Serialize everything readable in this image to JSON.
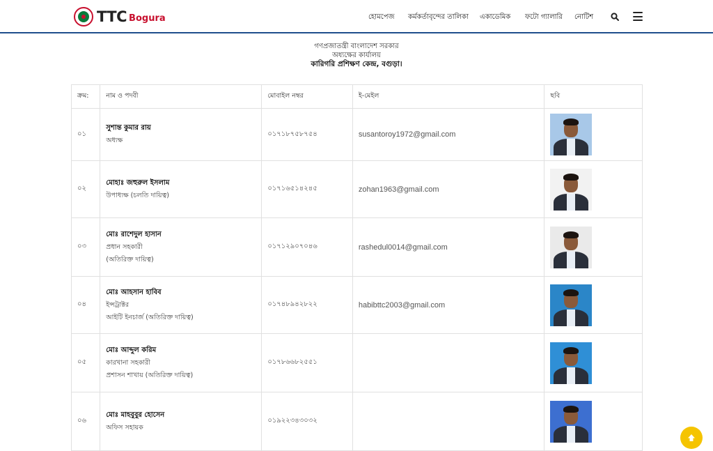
{
  "brand": {
    "name": "TTC",
    "city": "Bogura",
    "accent": "#c8102e",
    "nav_border": "#1f4e8c"
  },
  "nav": {
    "items": [
      "হোমপেজ",
      "কর্মকর্তাবৃন্দের তালিকা",
      "একাডেমিক",
      "ফটো গ্যালারি",
      "নোটিশ"
    ],
    "search_icon": "search-icon",
    "menu_icon": "hamburger-menu-icon"
  },
  "header": {
    "line1": "গণপ্রজাতন্ত্রী বাংলাদেশ সরকার",
    "line2": "অধ্যক্ষের কার্যালয়",
    "line3": "কারিগরি প্রশিক্ষণ কেন্দ্র, বগুড়া।"
  },
  "table": {
    "headers": [
      "ক্রম:",
      "নাম ও পদবী",
      "মোবাইল নম্বর",
      "ই-মেইল",
      "ছবি"
    ],
    "rows": [
      {
        "no": "০১",
        "name": "সুশান্ত কুমার রায়",
        "desig": [
          "অধ্যক্ষ"
        ],
        "mobile": "০১৭১৮৭৫৮৭৫৪",
        "email": "susantoroy1972@gmail.com",
        "photo_bg": "#a8c8e8"
      },
      {
        "no": "০২",
        "name": "মোহাঃ জহুরুল ইসলাম",
        "desig": [
          "উপাধ্যক্ষ (চলতি দায়িত্ব)"
        ],
        "mobile": "০১৭১৬৫১৪২৪৫",
        "email": "zohan1963@gmail.com",
        "photo_bg": "#f2f2f2"
      },
      {
        "no": "০৩",
        "name": "মোঃ রাশেদুল হাসান",
        "desig": [
          "প্রধান সহকারী",
          "(অতিরিক্ত দায়িত্ব)"
        ],
        "mobile": "০১৭১২৯০৭০৪৬",
        "email": "rashedul0014@gmail.com",
        "photo_bg": "#eaeaea"
      },
      {
        "no": "০৪",
        "name": "মোঃ আহসান হাবিব",
        "desig": [
          "ইন্সট্রাক্টর",
          "আইটি ইনচার্জ (অতিরিক্ত দায়িত্ব)"
        ],
        "mobile": "০১৭৪৮৯৪২৮২২",
        "email": "habibttc2003@gmail.com",
        "photo_bg": "#2b86c8"
      },
      {
        "no": "০৫",
        "name": "মোঃ আব্দুল করিম",
        "desig": [
          "কারখানা সহকারী",
          "প্রশাসন শাখায় (অতিরিক্ত দায়িত্ব)"
        ],
        "mobile": "০১৭৮৬৬৮২৫৫১",
        "email": "",
        "photo_bg": "#2f8fd6"
      },
      {
        "no": "০৬",
        "name": "মোঃ মাহবুবুর হোসেন",
        "desig": [
          "অফিস সহায়ক"
        ],
        "mobile": "০১৯২২৩৪৩০৩২",
        "email": "",
        "photo_bg": "#3d6fd0"
      }
    ]
  },
  "scroll_top_icon": "arrow-up-icon"
}
